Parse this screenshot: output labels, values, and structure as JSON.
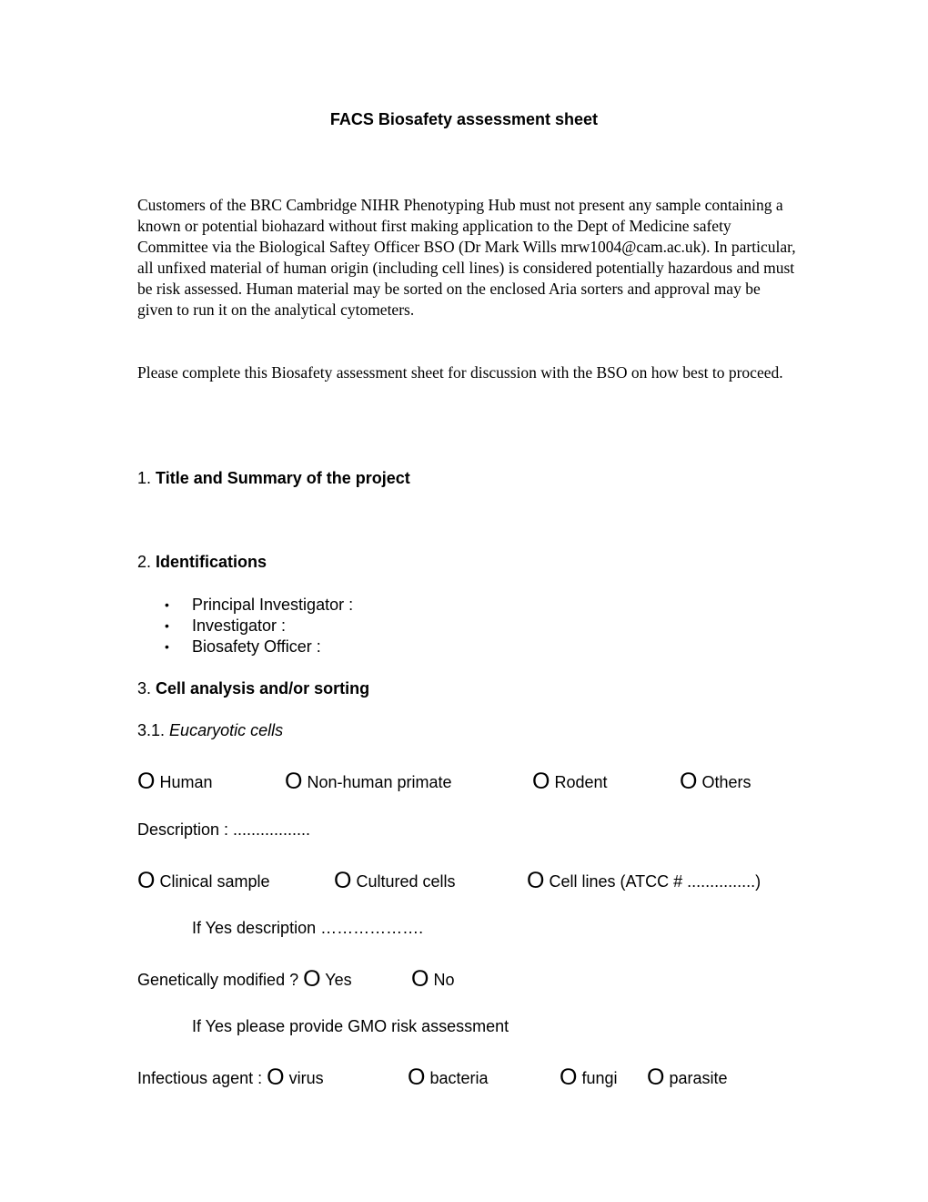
{
  "document": {
    "title": "FACS Biosafety assessment sheet",
    "intro_paragraph": "Customers of the BRC Cambridge NIHR Phenotyping Hub must not present any sample containing a known or potential biohazard without first making application to the Dept of Medicine safety Committee via the Biological Saftey Officer BSO (Dr Mark Wills mrw1004@cam.ac.uk). In particular, all unfixed material of human origin (including cell lines) is considered potentially hazardous and must be risk assessed. Human material may be sorted on the enclosed Aria sorters and approval may be given to run it on the analytical cytometers.",
    "instruction_paragraph": "Please complete this Biosafety assessment sheet for discussion with the BSO on how best to proceed."
  },
  "sections": {
    "s1": {
      "number": "1.",
      "title": "Title and Summary of the project"
    },
    "s2": {
      "number": "2.",
      "title": "Identifications",
      "items": [
        "Principal Investigator :",
        "Investigator :",
        "Biosafety Officer :"
      ]
    },
    "s3": {
      "number": "3.",
      "title": "Cell analysis and/or sorting"
    },
    "s3_1": {
      "number": "3.1.",
      "title": "Eucaryotic cells"
    }
  },
  "radio_glyph": "O",
  "bullet_glyph": "•",
  "origin_options": [
    "Human",
    "Non-human primate",
    "Rodent",
    "Others"
  ],
  "description_label": "Description : .................",
  "sample_options": [
    "Clinical sample",
    "Cultured cells",
    "Cell lines (ATCC # ...............)"
  ],
  "if_yes_description": "If Yes description ……………….",
  "genetically_modified": {
    "label": "Genetically modified ?",
    "options": [
      "Yes",
      "No"
    ]
  },
  "gmo_note": "If Yes please provide GMO risk assessment",
  "infectious_agent": {
    "label": "Infectious agent :",
    "options": [
      "virus",
      "bacteria",
      "fungi",
      "parasite"
    ]
  }
}
